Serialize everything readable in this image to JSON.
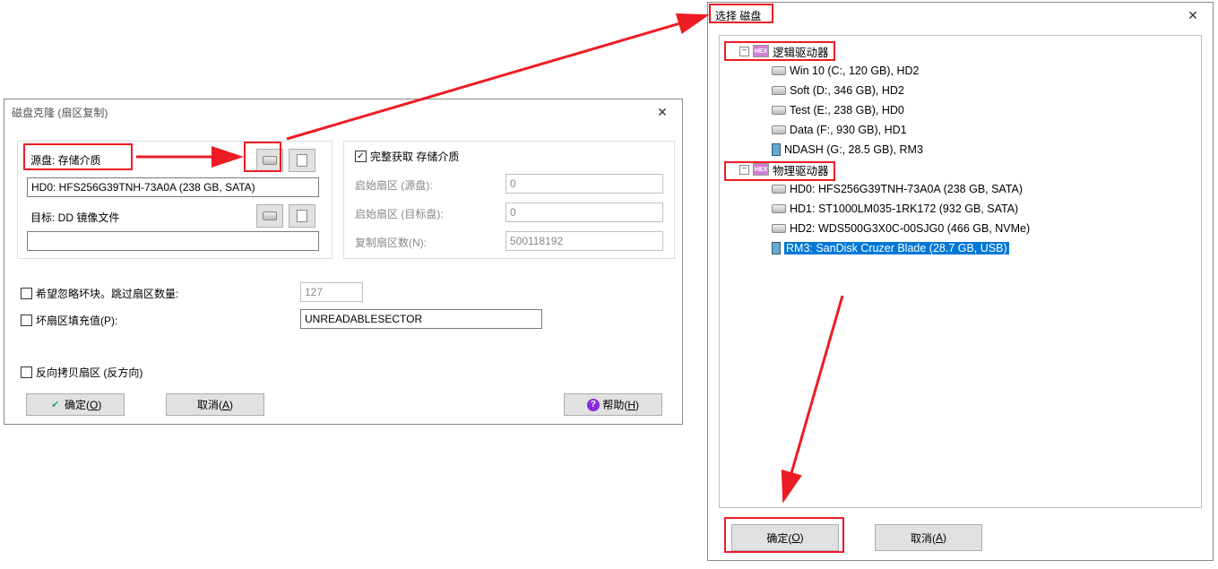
{
  "dialog1": {
    "title": "磁盘克隆 (扇区复制)",
    "source_label": "源盘: 存储介质",
    "source_value": "HD0: HFS256G39TNH-73A0A (238 GB, SATA)",
    "target_label": "目标: DD 镜像文件",
    "complete_acquire": "完整获取 存储介质",
    "start_sector_src": "启始扇区 (源盘):",
    "start_sector_dst": "启始扇区 (目标盘):",
    "start_sector_src_val": "0",
    "start_sector_dst_val": "0",
    "copy_count_label": "复制扇区数(N):",
    "copy_count_val": "500118192",
    "skip_bad_label": "希望忽略坏块。跳过扇区数量:",
    "skip_bad_val": "127",
    "fill_label": "坏扇区填充值(P):",
    "fill_val": "UNREADABLESECTOR",
    "reverse_label": "反向拷贝扇区 (反方向)",
    "ok": "确定(",
    "ok_key": "O",
    "ok_tail": ")",
    "cancel": "取消(",
    "cancel_key": "A",
    "cancel_tail": ")",
    "help": "帮助(",
    "help_key": "H",
    "help_tail": ")"
  },
  "dialog2": {
    "title": "选择 磁盘",
    "logical_label": "逻辑驱动器",
    "physical_label": "物理驱动器",
    "logical": [
      "Win 10 (C:, 120 GB), HD2",
      "Soft (D:, 346 GB), HD2",
      "Test (E:, 238 GB), HD0",
      "Data (F:, 930 GB), HD1",
      "NDASH (G:, 28.5 GB), RM3"
    ],
    "physical": [
      "HD0: HFS256G39TNH-73A0A (238 GB, SATA)",
      "HD1: ST1000LM035-1RK172 (932 GB, SATA)",
      "HD2: WDS500G3X0C-00SJG0 (466 GB, NVMe)",
      "RM3: SanDisk Cruzer Blade (28.7 GB, USB)"
    ],
    "ok": "确定(",
    "ok_key": "O",
    "ok_tail": ")",
    "cancel": "取消(",
    "cancel_key": "A",
    "cancel_tail": ")"
  }
}
